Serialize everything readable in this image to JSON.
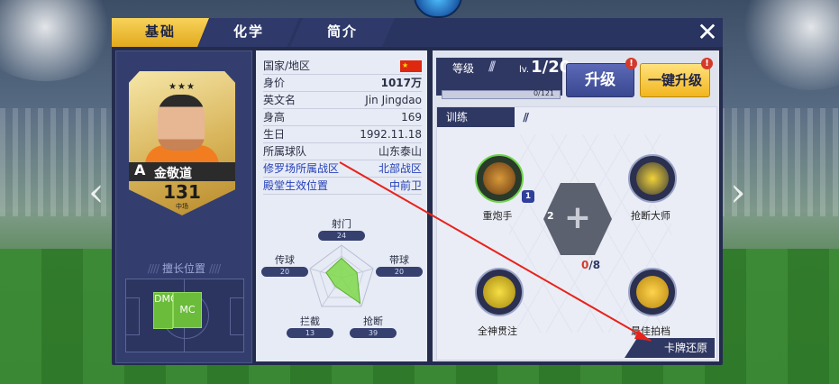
{
  "tabs": [
    {
      "label": "基础"
    },
    {
      "label": "化学"
    },
    {
      "label": "简介"
    }
  ],
  "close_icon": "close-icon",
  "card": {
    "grade": "A",
    "name": "金敬道",
    "rating": "131",
    "position": "中场",
    "stars": "★★★"
  },
  "preferred": {
    "title": "擅长位置",
    "positions": [
      "DMC",
      "MC"
    ]
  },
  "info": {
    "rows": [
      {
        "k": "国家/地区",
        "v": ""
      },
      {
        "k": "身价",
        "v": "1017万"
      },
      {
        "k": "英文名",
        "v": "Jin Jingdao"
      },
      {
        "k": "身高",
        "v": "169"
      },
      {
        "k": "生日",
        "v": "1992.11.18"
      },
      {
        "k": "所属球队",
        "v": "山东泰山"
      },
      {
        "k": "修罗场所属战区",
        "v": "北部战区"
      },
      {
        "k": "殿堂生效位置",
        "v": "中前卫"
      }
    ]
  },
  "stats": [
    {
      "label": "射门",
      "value": "24"
    },
    {
      "label": "传球",
      "value": "20"
    },
    {
      "label": "带球",
      "value": "20"
    },
    {
      "label": "拦截",
      "value": "13"
    },
    {
      "label": "抢断",
      "value": "39"
    }
  ],
  "level": {
    "label": "等级",
    "lv_prefix": "lv.",
    "value": "1/20",
    "exp": "0/121",
    "exp_fraction": 0
  },
  "buttons": {
    "upgrade": "升级",
    "one_click": "一键升级",
    "alert": "!"
  },
  "training": {
    "title": "训练",
    "skills": [
      {
        "name": "重炮手",
        "badge": "1"
      },
      {
        "name": "抢断大师",
        "badge": ""
      },
      {
        "name": "全神贯注",
        "badge": ""
      },
      {
        "name": "最佳拍档",
        "badge": ""
      }
    ],
    "center_left_num": "2",
    "count_current": "0",
    "count_sep": "/8",
    "restore": "卡牌还原"
  },
  "colors": {
    "accent_gold": "#f2b61f",
    "panel_dark": "#242c4e",
    "link_blue": "#2540b8",
    "alert_red": "#d43a2a",
    "pos_green": "#6cbc3c"
  }
}
